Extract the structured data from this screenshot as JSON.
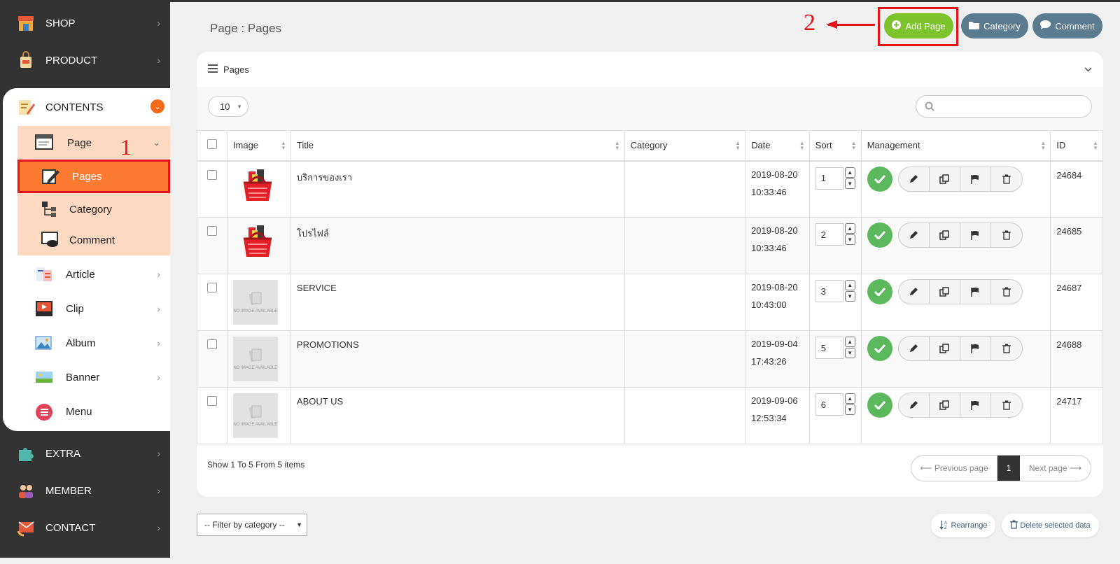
{
  "sidebar": {
    "shop": "SHOP",
    "product": "PRODUCT",
    "contents": "CONTENTS",
    "page": "Page",
    "pages": "Pages",
    "category": "Category",
    "comment": "Comment",
    "article": "Article",
    "clip": "Clip",
    "album": "Album",
    "banner": "Banner",
    "menu": "Menu",
    "extra": "EXTRA",
    "member": "MEMBER",
    "contact": "CONTACT"
  },
  "annotations": {
    "one": "1",
    "two": "2"
  },
  "header": {
    "title": "Page : Pages",
    "add_page": "Add Page",
    "category": "Category",
    "comment": "Comment"
  },
  "panel": {
    "title": "Pages",
    "page_length": "10",
    "columns": [
      "Image",
      "Title",
      "Category",
      "Date",
      "Sort",
      "Management",
      "ID"
    ],
    "rows": [
      {
        "title": "บริการของเรา",
        "category": "",
        "date": "2019-08-20",
        "time": "10:33:46",
        "sort": "1",
        "id": "24684"
      },
      {
        "title": "โปรไฟล์",
        "category": "",
        "date": "2019-08-20",
        "time": "10:33:46",
        "sort": "2",
        "id": "24685"
      },
      {
        "title": "SERVICE",
        "category": "",
        "date": "2019-08-20",
        "time": "10:43:00",
        "sort": "3",
        "id": "24687"
      },
      {
        "title": "PROMOTIONS",
        "category": "",
        "date": "2019-09-04",
        "time": "17:43:26",
        "sort": "5",
        "id": "24688"
      },
      {
        "title": "ABOUT US",
        "category": "",
        "date": "2019-09-06",
        "time": "12:53:34",
        "sort": "6",
        "id": "24717"
      }
    ],
    "no_image_text": "NO IMAGE AVAILABLE",
    "info": "Show 1 To 5 From 5 items",
    "prev": "⟵ Previous page",
    "current_page": "1",
    "next": "Next page ⟶"
  },
  "footer": {
    "filter": "-- Filter by category --",
    "rearrange": "Rearrange",
    "delete_selected": "Delete selected data"
  },
  "colors": {
    "accent_orange": "#fd7b31",
    "add_green": "#7dc32c",
    "slate": "#5b7b91",
    "annotation_red": "#e5141b"
  }
}
